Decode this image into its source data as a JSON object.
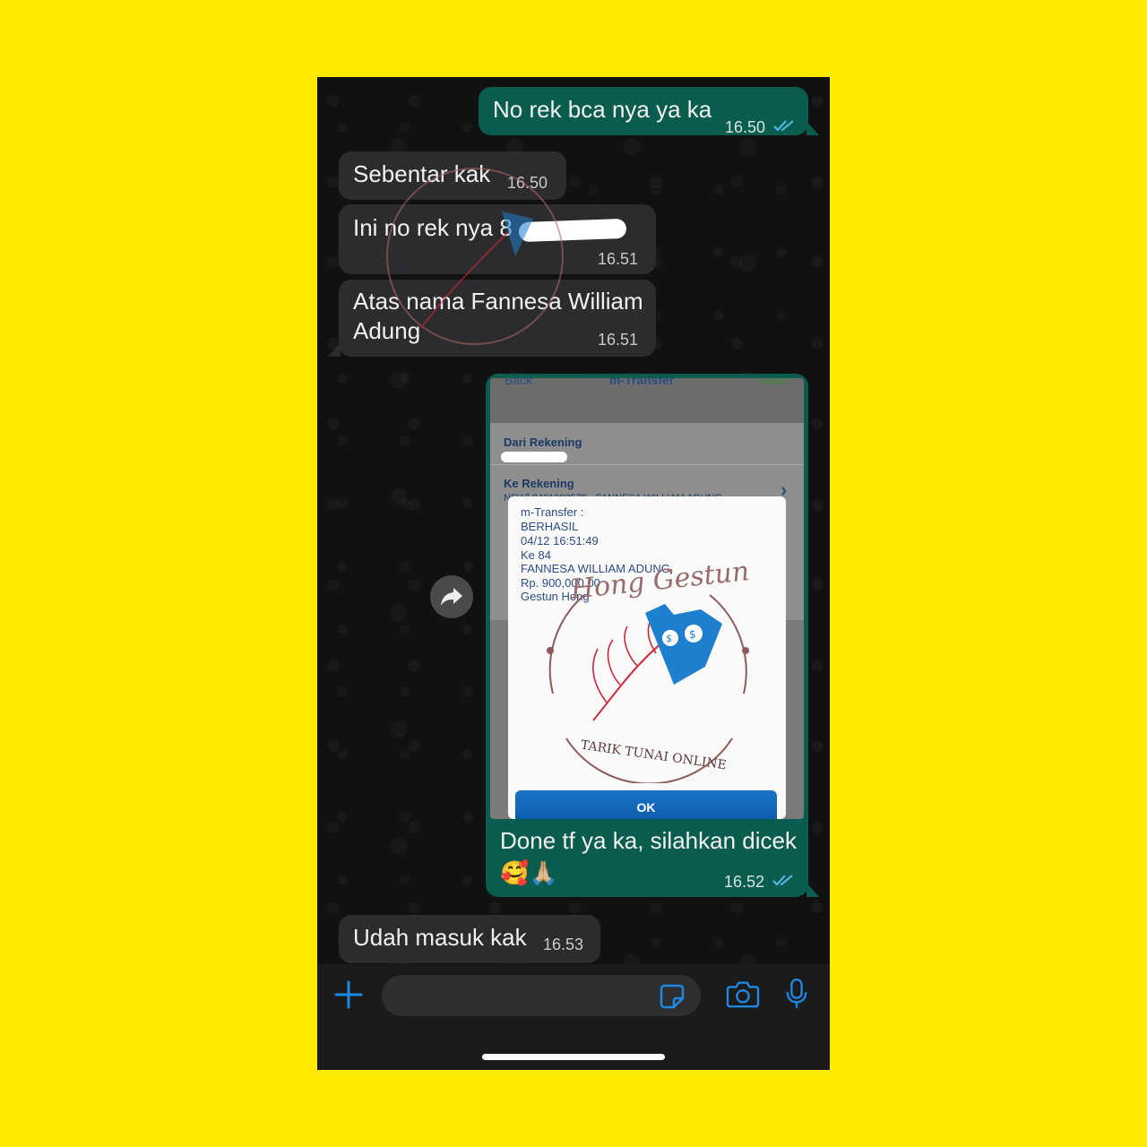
{
  "messages": {
    "m1": {
      "text": "No rek bca nya ya ka",
      "time": "16.50",
      "direction": "outgoing"
    },
    "m2": {
      "text": "Sebentar kak",
      "time": "16.50",
      "direction": "incoming"
    },
    "m3": {
      "text": "Ini no rek nya 8",
      "time": "16.51",
      "direction": "incoming"
    },
    "m4": {
      "line1": "Atas nama Fannesa William",
      "line2": "Adung",
      "time": "16.51",
      "direction": "incoming"
    },
    "m5": {
      "caption": "Done tf ya ka, silahkan dicek",
      "emoji": "🥰🙏🏼",
      "time": "16.52",
      "direction": "outgoing",
      "screenshot": {
        "top_left": "Back",
        "top_title": "m-Transfer",
        "top_right": "Send",
        "from_label": "Dari Rekening",
        "to_label": "Ke Rekening",
        "to_value": "NEW] 8421392579 - FANNESA WILLIAM ADUNG",
        "dialog_lines": [
          "m-Transfer :",
          "BERHASIL",
          "04/12 16:51:49",
          "Ke 84",
          "FANNESA WILLIAM ADUNG",
          "Rp. 900,000.00",
          "Gestun Hong"
        ],
        "ok_label": "OK"
      }
    },
    "m6": {
      "text": "Udah masuk kak",
      "time": "16.53",
      "direction": "incoming"
    }
  },
  "watermark": {
    "top_text": "Hong Gestun",
    "bottom_text": "TARIK TUNAI ONLINE"
  },
  "input_bar": {
    "icons": [
      "plus-icon",
      "sticker-icon",
      "camera-icon",
      "microphone-icon"
    ]
  },
  "colors": {
    "background": "#FFEB00",
    "outgoing_bubble": "#0a5c4f",
    "incoming_bubble": "#2c2c2e",
    "tick_blue": "#53bdeb",
    "accent_blue": "#1e88e5"
  }
}
